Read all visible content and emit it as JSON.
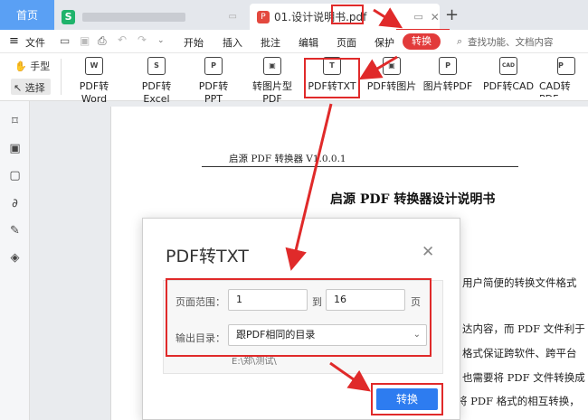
{
  "tabs": {
    "home": "首页",
    "spreadsheet_icon": "S",
    "doc_icon": "P",
    "doc_title": "01.设计说明书",
    "doc_ext": ".pdf"
  },
  "menu": {
    "file": "文件",
    "items": [
      "开始",
      "插入",
      "批注",
      "编辑",
      "页面",
      "保护",
      "转换"
    ],
    "search": "查找功能、文档内容"
  },
  "ribbon": {
    "hand": "手型",
    "select": "选择",
    "tools": [
      {
        "label": "PDF转Word",
        "icon": "W"
      },
      {
        "label": "PDF转Excel",
        "icon": "S"
      },
      {
        "label": "PDF转PPT",
        "icon": "P"
      },
      {
        "label": "转图片型PDF",
        "icon": "▣"
      },
      {
        "label": "PDF转TXT",
        "icon": "T"
      },
      {
        "label": "PDF转图片",
        "icon": "▣"
      },
      {
        "label": "图片转PDF",
        "icon": "P"
      },
      {
        "label": "PDF转CAD",
        "icon": "CAD"
      },
      {
        "label": "CAD转PDF",
        "icon": "P"
      }
    ]
  },
  "document": {
    "header": "启源 PDF 转换器 V1.0.0.1",
    "title": "启源 PDF 转换器设计说明书",
    "lines": [
      "用户简便的转换文件格式",
      "达内容，而 PDF 文件利于",
      "格式保证跨软件、跨平台",
      "也需要将 PDF 文件转换成",
      "将 PDF 格式的相互转换，"
    ]
  },
  "dialog": {
    "title": "PDF转TXT",
    "range_label": "页面范围：",
    "range_from": "1",
    "range_to_label": "到",
    "range_to": "16",
    "range_unit": "页",
    "output_label": "输出目录：",
    "output_value": "跟PDF相同的目录",
    "output_path": "E:\\郑\\测试\\",
    "convert_button": "转换"
  }
}
